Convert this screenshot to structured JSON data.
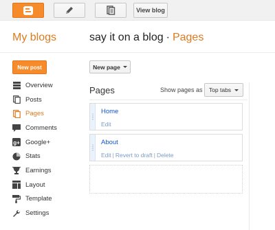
{
  "topbar": {
    "view_blog_label": "View blog"
  },
  "header": {
    "my_blogs": "My blogs",
    "blog_name": "say it on a blog",
    "separator": "·",
    "section": "Pages"
  },
  "sidebar": {
    "new_post_label": "New post",
    "items": [
      {
        "label": "Overview",
        "icon": "overview-icon"
      },
      {
        "label": "Posts",
        "icon": "posts-icon"
      },
      {
        "label": "Pages",
        "icon": "pages-icon",
        "active": true
      },
      {
        "label": "Comments",
        "icon": "comments-icon"
      },
      {
        "label": "Google+",
        "icon": "google-plus-icon"
      },
      {
        "label": "Stats",
        "icon": "stats-icon"
      },
      {
        "label": "Earnings",
        "icon": "earnings-icon"
      },
      {
        "label": "Layout",
        "icon": "layout-icon"
      },
      {
        "label": "Template",
        "icon": "template-icon"
      },
      {
        "label": "Settings",
        "icon": "settings-icon"
      }
    ]
  },
  "main": {
    "new_page_label": "New page",
    "heading": "Pages",
    "show_pages_as_label": "Show pages as",
    "show_pages_as_value": "Top tabs",
    "pages": [
      {
        "title": "Home",
        "actions": [
          "Edit"
        ]
      },
      {
        "title": "About",
        "actions": [
          "Edit",
          "Revert to draft",
          "Delete"
        ]
      }
    ],
    "action_separator": "|"
  },
  "colors": {
    "accent": "#dd7a1f",
    "button_orange": "#f58b2a",
    "link": "#15c"
  }
}
